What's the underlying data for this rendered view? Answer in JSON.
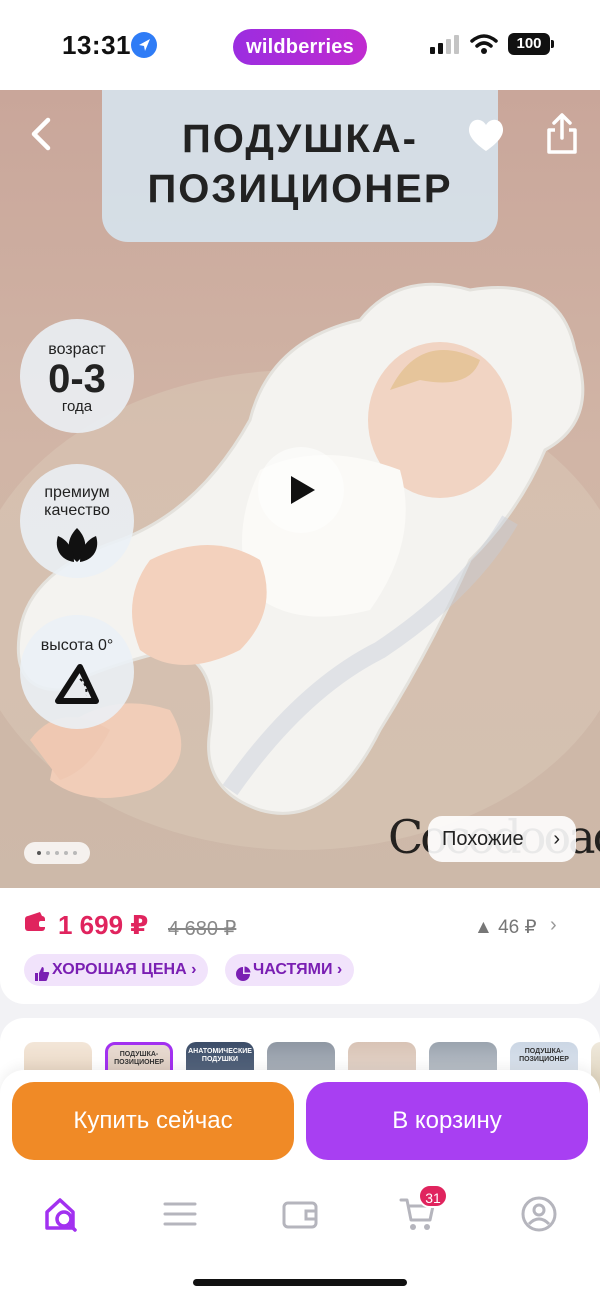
{
  "status_bar": {
    "time": "13:31",
    "brand": "wildberries",
    "battery": "100"
  },
  "product": {
    "title_line1": "ПОДУШКА-",
    "title_line2": "ПОЗИЦИОНЕР",
    "badges": [
      {
        "top": "возраст",
        "big": "0-3",
        "bottom": "года"
      },
      {
        "top": "премиум",
        "second": "качество"
      },
      {
        "top": "высота 0°"
      }
    ],
    "watermark": "Cocodooaou",
    "similar_label": "Похожие",
    "pager": {
      "count": 5,
      "active": 0
    }
  },
  "price": {
    "current": "1 699 ₽",
    "old": "4 680 ₽",
    "delta": "▲ 46 ₽",
    "tags": [
      {
        "label": "ХОРОШАЯ ЦЕНА ›"
      },
      {
        "label": "ЧАСТЯМИ ›"
      }
    ]
  },
  "thumbnails": [
    {
      "label": ""
    },
    {
      "label": "ПОДУШКА- ПОЗИЦИОНЕР"
    },
    {
      "label": "АНАТОМИЧЕСКИЕ ПОДУШКИ"
    },
    {
      "label": ""
    },
    {
      "label": ""
    },
    {
      "label": ""
    },
    {
      "label": "ПОДУШКА- ПОЗИЦИОНЕР"
    }
  ],
  "actions": {
    "buy_now": "Купить сейчас",
    "add_to_cart": "В корзину"
  },
  "bottom_nav": {
    "cart_count": "31"
  },
  "colors": {
    "brand_purple": "#a83ff2",
    "buy_orange": "#f08a26",
    "price_red": "#e0245e"
  },
  "icons": {
    "back": "chevron-left-icon",
    "favorite": "heart-icon",
    "share": "share-icon",
    "play": "play-icon",
    "home": "home-search-icon",
    "catalog": "menu-icon",
    "wallet": "wallet-icon",
    "cart": "cart-icon",
    "profile": "profile-icon"
  }
}
